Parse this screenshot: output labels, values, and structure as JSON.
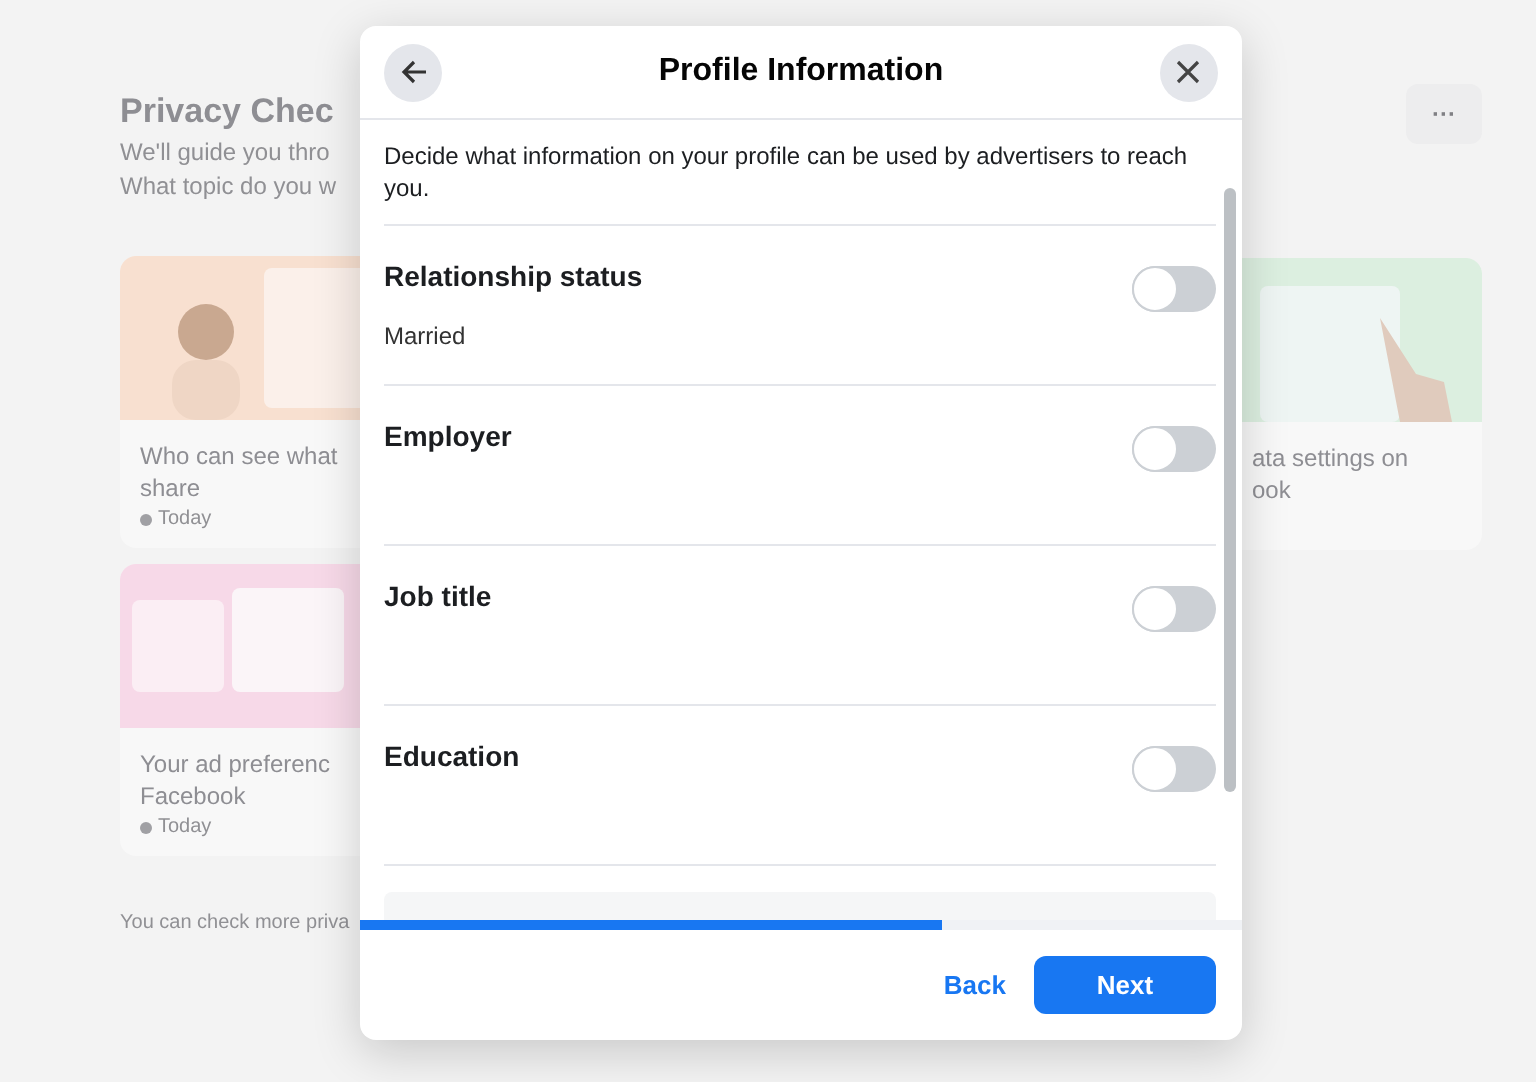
{
  "background": {
    "title": "Privacy Chec",
    "subtitle_lines": [
      "We'll guide you thro",
      "What topic do you w"
    ],
    "more_button": "···",
    "cards": [
      {
        "kind": "orange",
        "title_lines": [
          "Who can see what",
          "share"
        ],
        "time": "Today"
      },
      {
        "kind": "pink",
        "title_lines": [
          "Your ad preferenc",
          "Facebook"
        ],
        "time": "Today"
      }
    ],
    "right_card": {
      "kind": "green",
      "title_lines": [
        "ata settings on",
        "ook"
      ]
    },
    "footer_note": "You can check more priva"
  },
  "dialog": {
    "title": "Profile Information",
    "description": "Decide what information on your profile can be used by advertisers to reach you.",
    "items": [
      {
        "label": "Relationship status",
        "value": "Married",
        "on": false
      },
      {
        "label": "Employer",
        "on": false
      },
      {
        "label": "Job title",
        "on": false
      },
      {
        "label": "Education",
        "on": false
      }
    ],
    "progress": {
      "level": 0.66
    },
    "buttons": [
      {
        "label": "Back",
        "kind": "link"
      },
      {
        "label": "Next",
        "kind": "primary"
      }
    ]
  }
}
